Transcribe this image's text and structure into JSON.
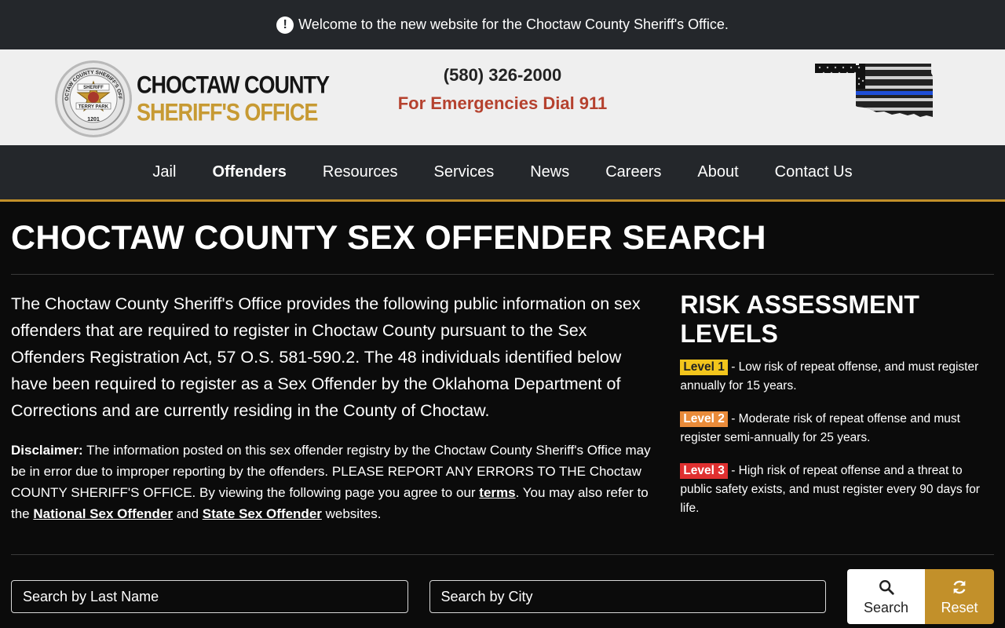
{
  "announcement": {
    "icon": "alert-circle-icon",
    "text": "Welcome to the new website for the Choctaw County Sheriff's Office."
  },
  "header": {
    "logo_line1": "CHOCTAW COUNTY",
    "logo_line2": "SHERIFF'S OFFICE",
    "badge_ring": "CHOCTAW COUNTY SHERIFF'S OFFICE",
    "badge_sheriff": "SHERIFF",
    "badge_name": "TERRY PARK",
    "badge_number": "1201",
    "phone": "(580) 326-2000",
    "emergency": "For Emergencies Dial 911",
    "flag_icon": "oklahoma-thin-blue-line-flag-icon"
  },
  "nav": {
    "items": [
      {
        "label": "Jail"
      },
      {
        "label": "Offenders"
      },
      {
        "label": "Resources"
      },
      {
        "label": "Services"
      },
      {
        "label": "News"
      },
      {
        "label": "Careers"
      },
      {
        "label": "About"
      },
      {
        "label": "Contact Us"
      }
    ],
    "active": "Offenders"
  },
  "page": {
    "title": "CHOCTAW COUNTY SEX OFFENDER SEARCH",
    "intro": "The Choctaw County Sheriff's Office provides the following public information on sex offenders that are required to register in Choctaw County pursuant to the Sex Offenders Registration Act, 57 O.S. 581-590.2. The 48 individuals identified below have been required to register as a Sex Offender by the Oklahoma Department of Corrections and are currently residing in the County of Choctaw.",
    "disclaimer": {
      "label": "Disclaimer:",
      "text1": " The information posted on this sex offender registry by the Choctaw County Sheriff's Office may be in error due to improper reporting by the offenders. PLEASE REPORT ANY ERRORS TO THE Choctaw COUNTY SHERIFF'S OFFICE. By viewing the following page you agree to our ",
      "terms_link": "terms",
      "text2": ". You may also refer to the ",
      "national_link": "National Sex Offender",
      "text3": " and ",
      "state_link": "State Sex Offender",
      "text4": " websites."
    }
  },
  "risk": {
    "title": "RISK ASSESSMENT LEVELS",
    "levels": [
      {
        "tag": "Level 1",
        "text": " - Low risk of repeat offense, and must register annually for 15 years.",
        "color": "#f2c51c"
      },
      {
        "tag": "Level 2",
        "text": " - Moderate risk of repeat offense and must register semi-annually for 25 years.",
        "color": "#e98b3a"
      },
      {
        "tag": "Level 3",
        "text": " - High risk of repeat offense and a threat to public safety exists, and must register every 90 days for life.",
        "color": "#e03030"
      }
    ]
  },
  "search": {
    "last_name_placeholder": "Search by Last Name",
    "city_placeholder": "Search by City",
    "search_label": "Search",
    "search_icon": "search-icon",
    "reset_label": "Reset",
    "reset_icon": "refresh-icon"
  },
  "colors": {
    "accent": "#c2902a",
    "nav_bg": "#24272b",
    "page_bg": "#0b0b0b",
    "emergency": "#b5412e"
  }
}
